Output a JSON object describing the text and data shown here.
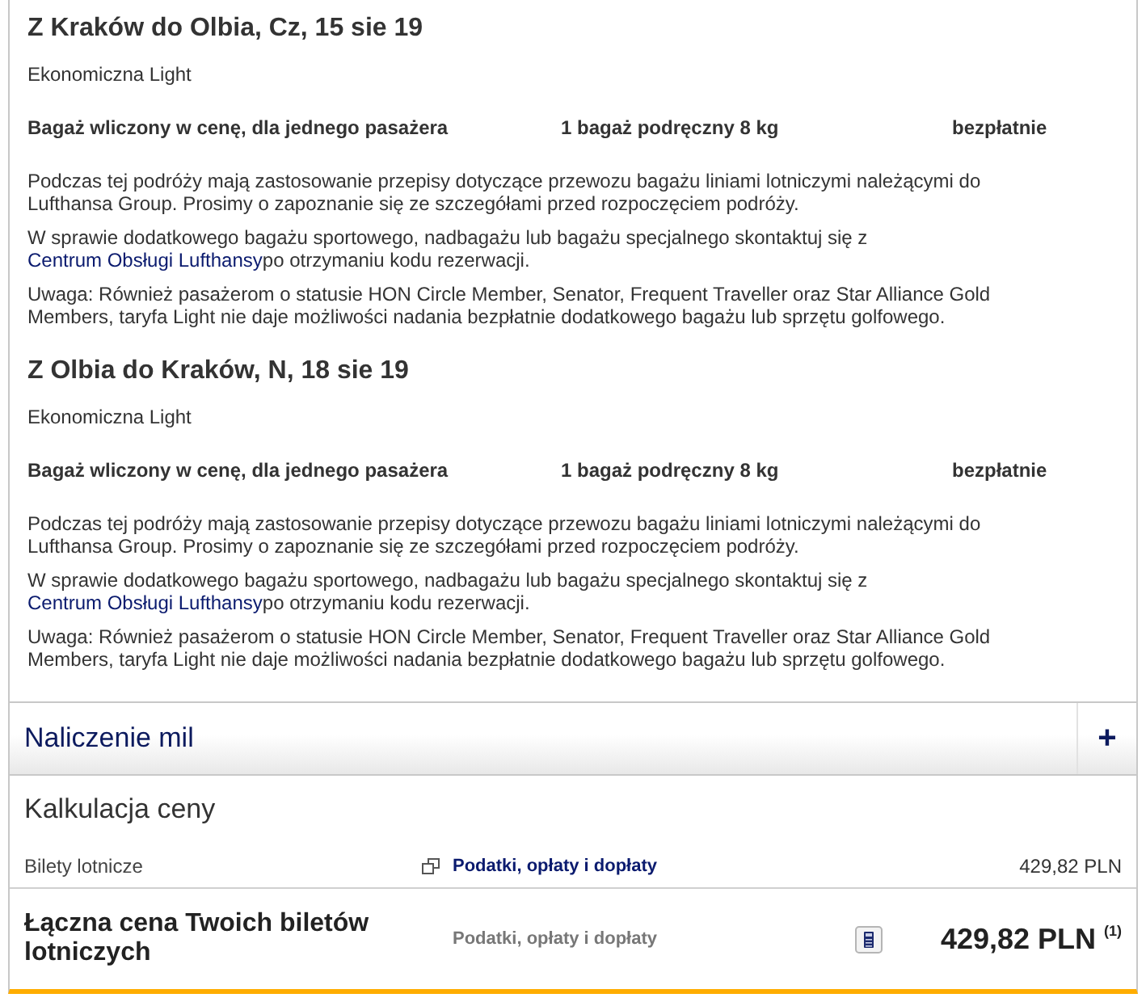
{
  "segments": [
    {
      "title": "Z Kraków do Olbia, Cz, 15 sie 19",
      "fare": "Ekonomiczna Light",
      "baggage": {
        "label": "Bagaż wliczony w cenę, dla jednego pasażera",
        "item": "1 bagaż podręczny 8 kg",
        "price": "bezpłatnie"
      },
      "notes": [
        {
          "text": "Podczas tej podróży mają zastosowanie przepisy dotyczące przewozu bagażu liniami lotniczymi należącymi do Lufthansa Group. Prosimy o zapoznanie się ze szczegółami przed rozpoczęciem podróży."
        },
        {
          "text": "W sprawie dodatkowego bagażu sportowego, nadbagażu lub bagażu specjalnego skontaktuj się z ",
          "link": "Centrum Obsługi Lufthansy",
          "after": "po otrzymaniu kodu rezerwacji."
        },
        {
          "text": "Uwaga: Również pasażerom o statusie HON Circle Member, Senator, Frequent Traveller oraz Star Alliance Gold Members, taryfa Light nie daje możliwości nadania bezpłatnie dodatkowego bagażu lub sprzętu golfowego."
        }
      ]
    },
    {
      "title": "Z Olbia do Kraków, N, 18 sie 19",
      "fare": "Ekonomiczna Light",
      "baggage": {
        "label": "Bagaż wliczony w cenę, dla jednego pasażera",
        "item": "1 bagaż podręczny 8 kg",
        "price": "bezpłatnie"
      },
      "notes": [
        {
          "text": "Podczas tej podróży mają zastosowanie przepisy dotyczące przewozu bagażu liniami lotniczymi należącymi do Lufthansa Group. Prosimy o zapoznanie się ze szczegółami przed rozpoczęciem podróży."
        },
        {
          "text": "W sprawie dodatkowego bagażu sportowego, nadbagażu lub bagażu specjalnego skontaktuj się z ",
          "link": "Centrum Obsługi Lufthansy",
          "after": "po otrzymaniu kodu rezerwacji."
        },
        {
          "text": "Uwaga: Również pasażerom o statusie HON Circle Member, Senator, Frequent Traveller oraz Star Alliance Gold Members, taryfa Light nie daje możliwości nadania bezpłatnie dodatkowego bagażu lub sprzętu golfowego."
        }
      ]
    }
  ],
  "miles": {
    "title": "Naliczenie mil",
    "toggle": "+"
  },
  "price": {
    "title": "Kalkulacja ceny",
    "rows": [
      {
        "label": "Bilety lotnicze",
        "link": "Podatki, opłaty i dopłaty",
        "amount": "429,82 PLN"
      }
    ],
    "total": {
      "label": "Łączna cena Twoich biletów lotniczych",
      "note": "Podatki, opłaty i dopłaty",
      "amount": "429,82 PLN $^{(1)}$"
    }
  }
}
